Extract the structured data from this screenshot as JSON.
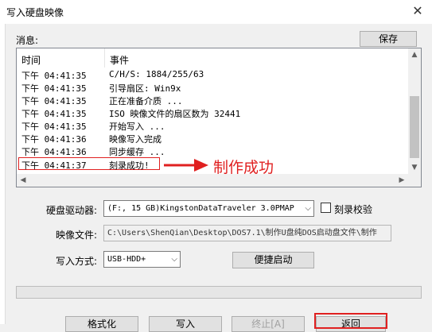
{
  "window": {
    "title": "写入硬盘映像",
    "close_glyph": "✕"
  },
  "messages": {
    "label": "消息:",
    "save_label": "保存",
    "columns": [
      "时间",
      "事件"
    ],
    "rows": [
      {
        "time": "下午 04:41:35",
        "event": "C/H/S: 1884/255/63"
      },
      {
        "time": "下午 04:41:35",
        "event": "引导扇区: Win9x"
      },
      {
        "time": "下午 04:41:35",
        "event": "正在准备介质 ..."
      },
      {
        "time": "下午 04:41:35",
        "event": "ISO 映像文件的扇区数为 32441"
      },
      {
        "time": "下午 04:41:35",
        "event": "开始写入 ..."
      },
      {
        "time": "下午 04:41:36",
        "event": "映像写入完成"
      },
      {
        "time": "下午 04:41:36",
        "event": "同步缓存 ..."
      },
      {
        "time": "下午 04:41:37",
        "event": "刻录成功!"
      }
    ],
    "annotation": "制作成功"
  },
  "drive": {
    "label": "硬盘驱动器:",
    "value": "(F:, 15 GB)KingstonDataTraveler 3.0PMAP",
    "verify_label": "刻录校验",
    "verify_checked": false
  },
  "image_file": {
    "label": "映像文件:",
    "value": "C:\\Users\\ShenQian\\Desktop\\DOS7.1\\制作U盘纯DOS启动盘文件\\制作"
  },
  "write_mode": {
    "label": "写入方式:",
    "value": "USB-HDD+",
    "quick_boot_label": "便捷启动"
  },
  "progress": {
    "percent": 0
  },
  "buttons": {
    "format": "格式化",
    "write": "写入",
    "abort": "终止[A]",
    "return": "返回"
  },
  "colors": {
    "annotation": "#e02020",
    "progress": "#06b025"
  }
}
